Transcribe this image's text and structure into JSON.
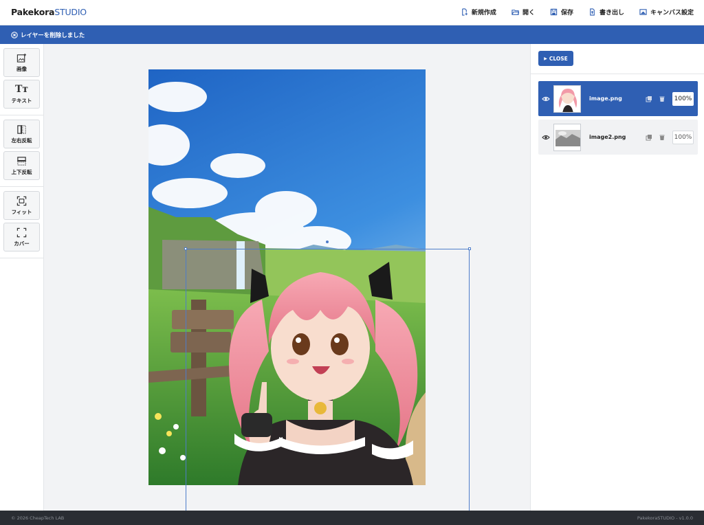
{
  "app": {
    "brand_bold": "Pakekora",
    "brand_rest": "STUDIO"
  },
  "header_menu": [
    {
      "label": "新規作成",
      "icon": "new-file-icon"
    },
    {
      "label": "開く",
      "icon": "folder-open-icon"
    },
    {
      "label": "保存",
      "icon": "save-icon"
    },
    {
      "label": "書き出し",
      "icon": "export-icon"
    },
    {
      "label": "キャンバス設定",
      "icon": "canvas-settings-icon"
    }
  ],
  "notice": {
    "text": "レイヤーを削除しました",
    "icon": "x-circle-icon"
  },
  "tools": [
    {
      "label": "画像",
      "icon": "add-image-icon"
    },
    {
      "label": "テキスト",
      "icon": "text-icon"
    },
    {
      "label": "左右反転",
      "icon": "flip-horizontal-icon"
    },
    {
      "label": "上下反転",
      "icon": "flip-vertical-icon"
    },
    {
      "label": "フィット",
      "icon": "fit-icon"
    },
    {
      "label": "カバー",
      "icon": "cover-icon"
    }
  ],
  "panel": {
    "close_label": "CLOSE"
  },
  "layers": [
    {
      "name": "image.png",
      "opacity": "100%",
      "active": true
    },
    {
      "name": "image2.png",
      "opacity": "100%",
      "active": false
    }
  ],
  "footer": {
    "left": "© 2026 CheapTech LAB",
    "right": "PakekoraSTUDIO - v1.0.0"
  },
  "colors": {
    "accent": "#2f5fb3",
    "footer_bg": "#2a2d33"
  }
}
